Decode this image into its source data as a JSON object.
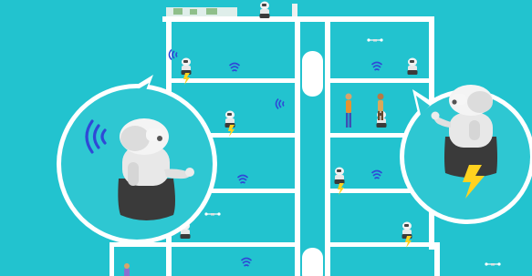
{
  "scene": {
    "colors": {
      "background": "#22c3cf",
      "floor": "#ffffff",
      "bubble_fill": "#2ec7d2",
      "bubble_outline": "#ffffff",
      "signal": "#2f49d6",
      "lightning": "#ffd21f",
      "robot_body": "#ececec",
      "robot_skirt": "#3a3a3a"
    },
    "icons": [
      "robot-icon",
      "wifi-signal-icon",
      "lightning-bolt-icon",
      "person-icon",
      "drone-icon",
      "speech-bubble-icon"
    ]
  }
}
